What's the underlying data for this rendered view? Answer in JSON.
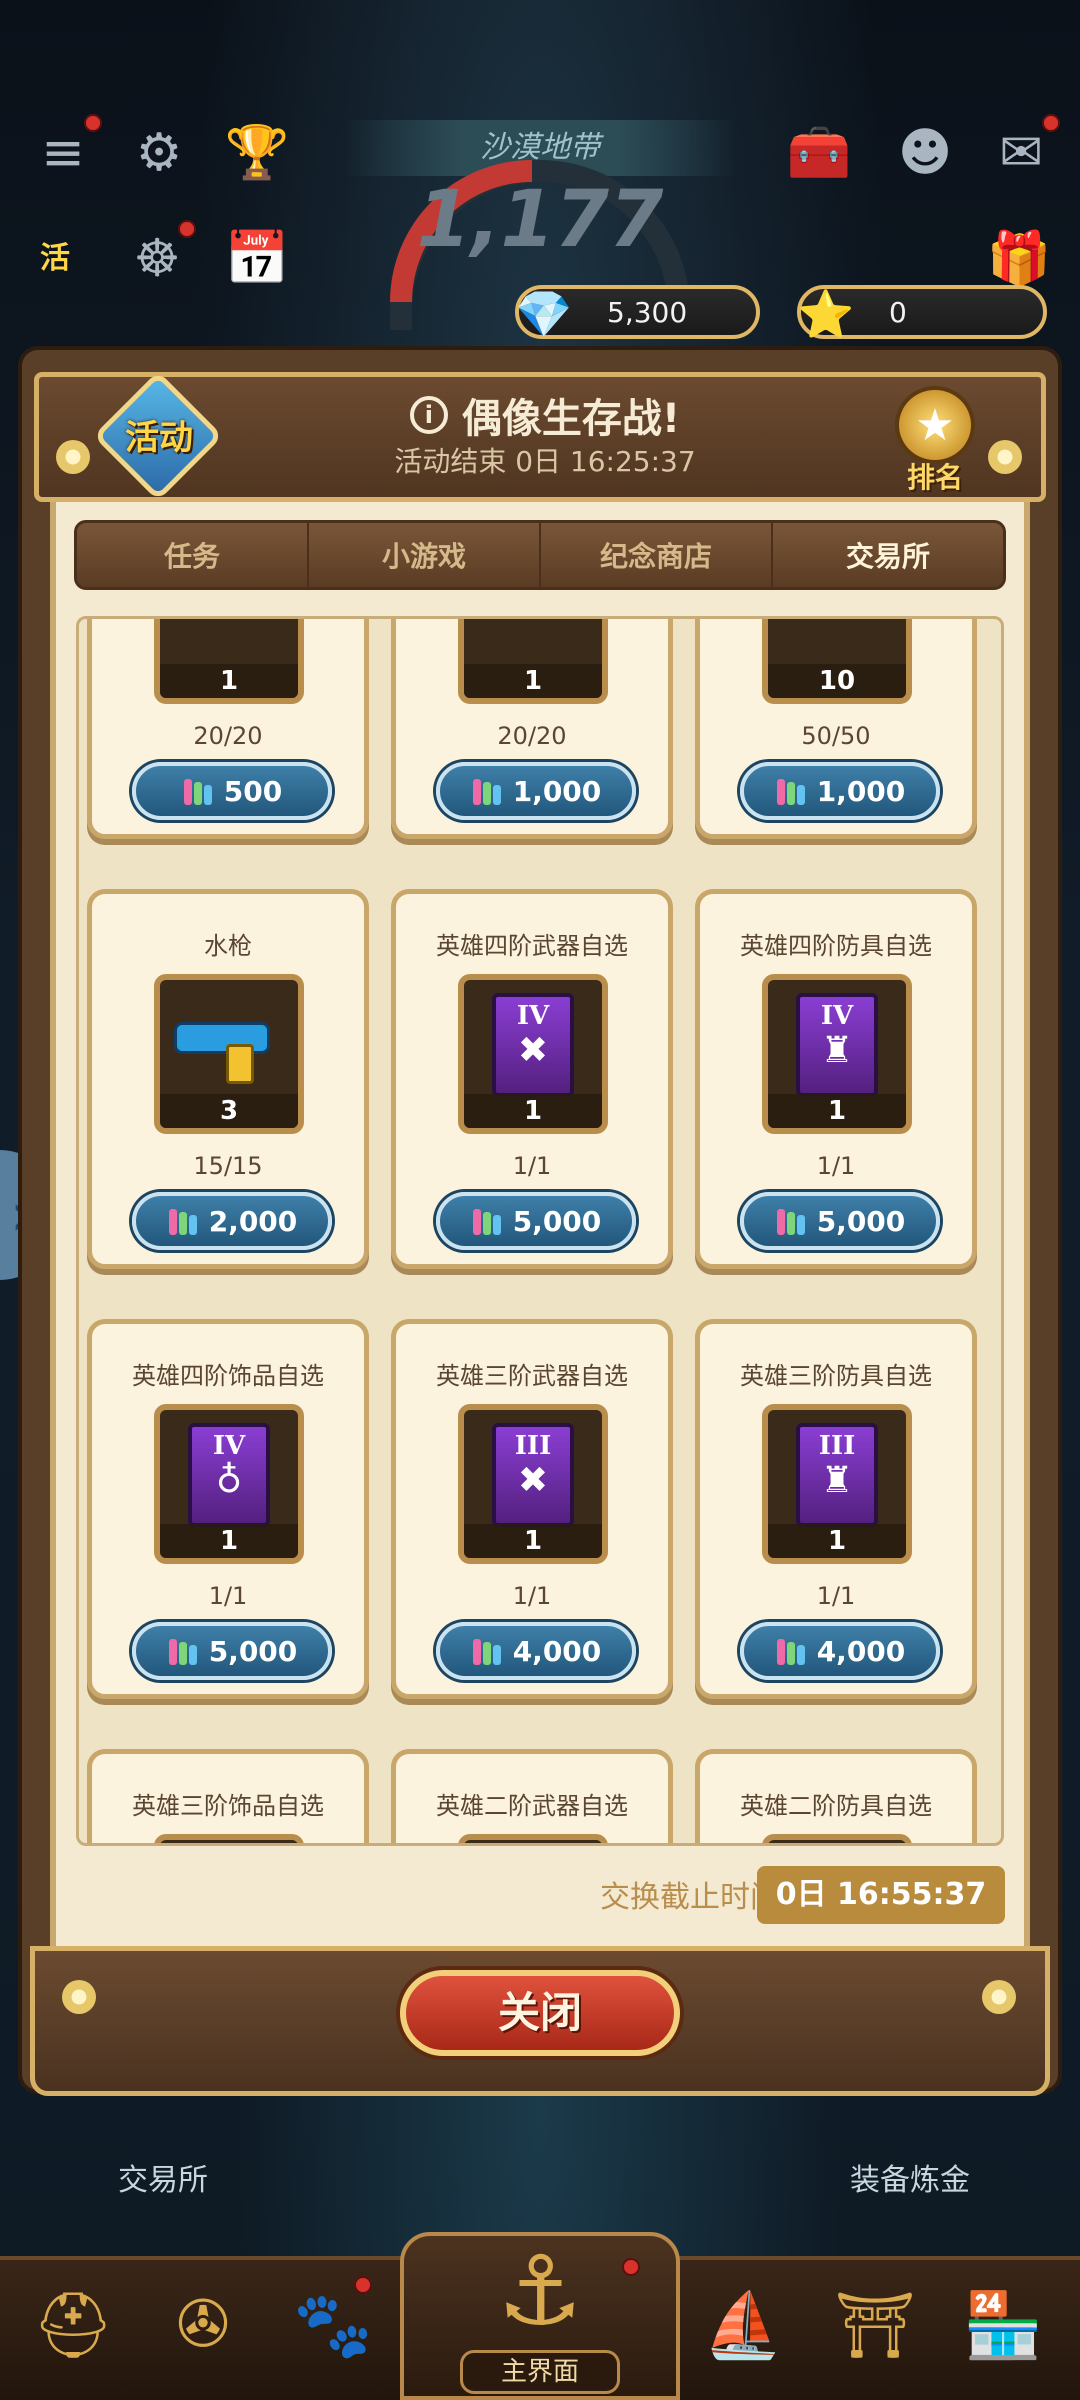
{
  "top": {
    "zone_name": "沙漠地带",
    "power": "1,177",
    "currency_gems": "5,300",
    "currency_stars": "0"
  },
  "header": {
    "activity_badge": "活动",
    "title": "偶像生存战!",
    "ends_in": "活动结束 0日 16:25:37",
    "rank_label": "排名"
  },
  "tabs": [
    {
      "label": "任务"
    },
    {
      "label": "小游戏"
    },
    {
      "label": "纪念商店"
    },
    {
      "label": "交易所"
    }
  ],
  "items": [
    {
      "name": "",
      "qty": "1",
      "stock": "20/20",
      "price": "500",
      "icon": "unknown-item-icon"
    },
    {
      "name": "",
      "qty": "1",
      "stock": "20/20",
      "price": "1,000",
      "icon": "unknown-item-icon"
    },
    {
      "name": "",
      "qty": "10",
      "stock": "50/50",
      "price": "1,000",
      "icon": "unknown-item-icon"
    },
    {
      "name": "水枪",
      "qty": "3",
      "stock": "15/15",
      "price": "2,000",
      "icon": "water-gun-icon"
    },
    {
      "name": "英雄四阶武器自选",
      "qty": "1",
      "stock": "1/1",
      "price": "5,000",
      "icon": "weapon-book-icon",
      "tier": "IV",
      "mark": "✖"
    },
    {
      "name": "英雄四阶防具自选",
      "qty": "1",
      "stock": "1/1",
      "price": "5,000",
      "icon": "armor-book-icon",
      "tier": "IV",
      "mark": "♜"
    },
    {
      "name": "英雄四阶饰品自选",
      "qty": "1",
      "stock": "1/1",
      "price": "5,000",
      "icon": "accessory-book-icon",
      "tier": "IV",
      "mark": "♁"
    },
    {
      "name": "英雄三阶武器自选",
      "qty": "1",
      "stock": "1/1",
      "price": "4,000",
      "icon": "weapon-book-icon",
      "tier": "III",
      "mark": "✖"
    },
    {
      "name": "英雄三阶防具自选",
      "qty": "1",
      "stock": "1/1",
      "price": "4,000",
      "icon": "armor-book-icon",
      "tier": "III",
      "mark": "♜"
    },
    {
      "name": "英雄三阶饰品自选",
      "qty": "",
      "stock": "",
      "price": "",
      "icon": "accessory-book-icon",
      "tier": "III",
      "mark": ""
    },
    {
      "name": "英雄二阶武器自选",
      "qty": "",
      "stock": "",
      "price": "",
      "icon": "weapon-book-icon",
      "tier": "II",
      "mark": ""
    },
    {
      "name": "英雄二阶防具自选",
      "qty": "",
      "stock": "",
      "price": "",
      "icon": "armor-book-icon",
      "tier": "II",
      "mark": ""
    }
  ],
  "deadline": {
    "label": "交换截止时间",
    "value": "0日 16:55:37"
  },
  "close_label": "关闭",
  "under_labels": {
    "exchange": "交易所",
    "equip": "装备炼金"
  },
  "nav": {
    "main_label": "主界面"
  },
  "colors": {
    "panel_brown": "#5a3f28",
    "parchment": "#f4ead1",
    "gold_border": "#d7b067",
    "price_blue": "#2f6c93",
    "close_red": "#c23a27"
  }
}
